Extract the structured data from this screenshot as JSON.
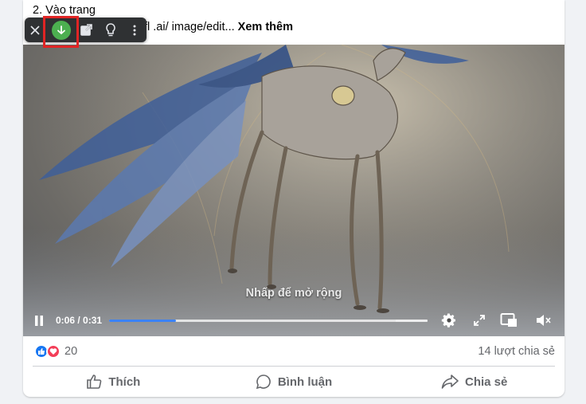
{
  "post": {
    "line1": "2. Vào trang",
    "line2_prefix": "fl .ai/ image/edit... ",
    "see_more": "Xem thêm"
  },
  "video": {
    "expand_text": "Nhấp để mở rộng",
    "time": "0:06 / 0:31",
    "progress": 0.21,
    "buffered": 0.9
  },
  "stats": {
    "reaction_count": "20",
    "shares": "14 lượt chia sẻ"
  },
  "actions": {
    "like": "Thích",
    "comment": "Bình luận",
    "share": "Chia sẻ"
  },
  "colors": {
    "download_accent": "#4caf50",
    "highlight": "#e02424",
    "progress": "#3b82f6",
    "like_blue": "#1877f2",
    "love_red": "#f33e58"
  }
}
